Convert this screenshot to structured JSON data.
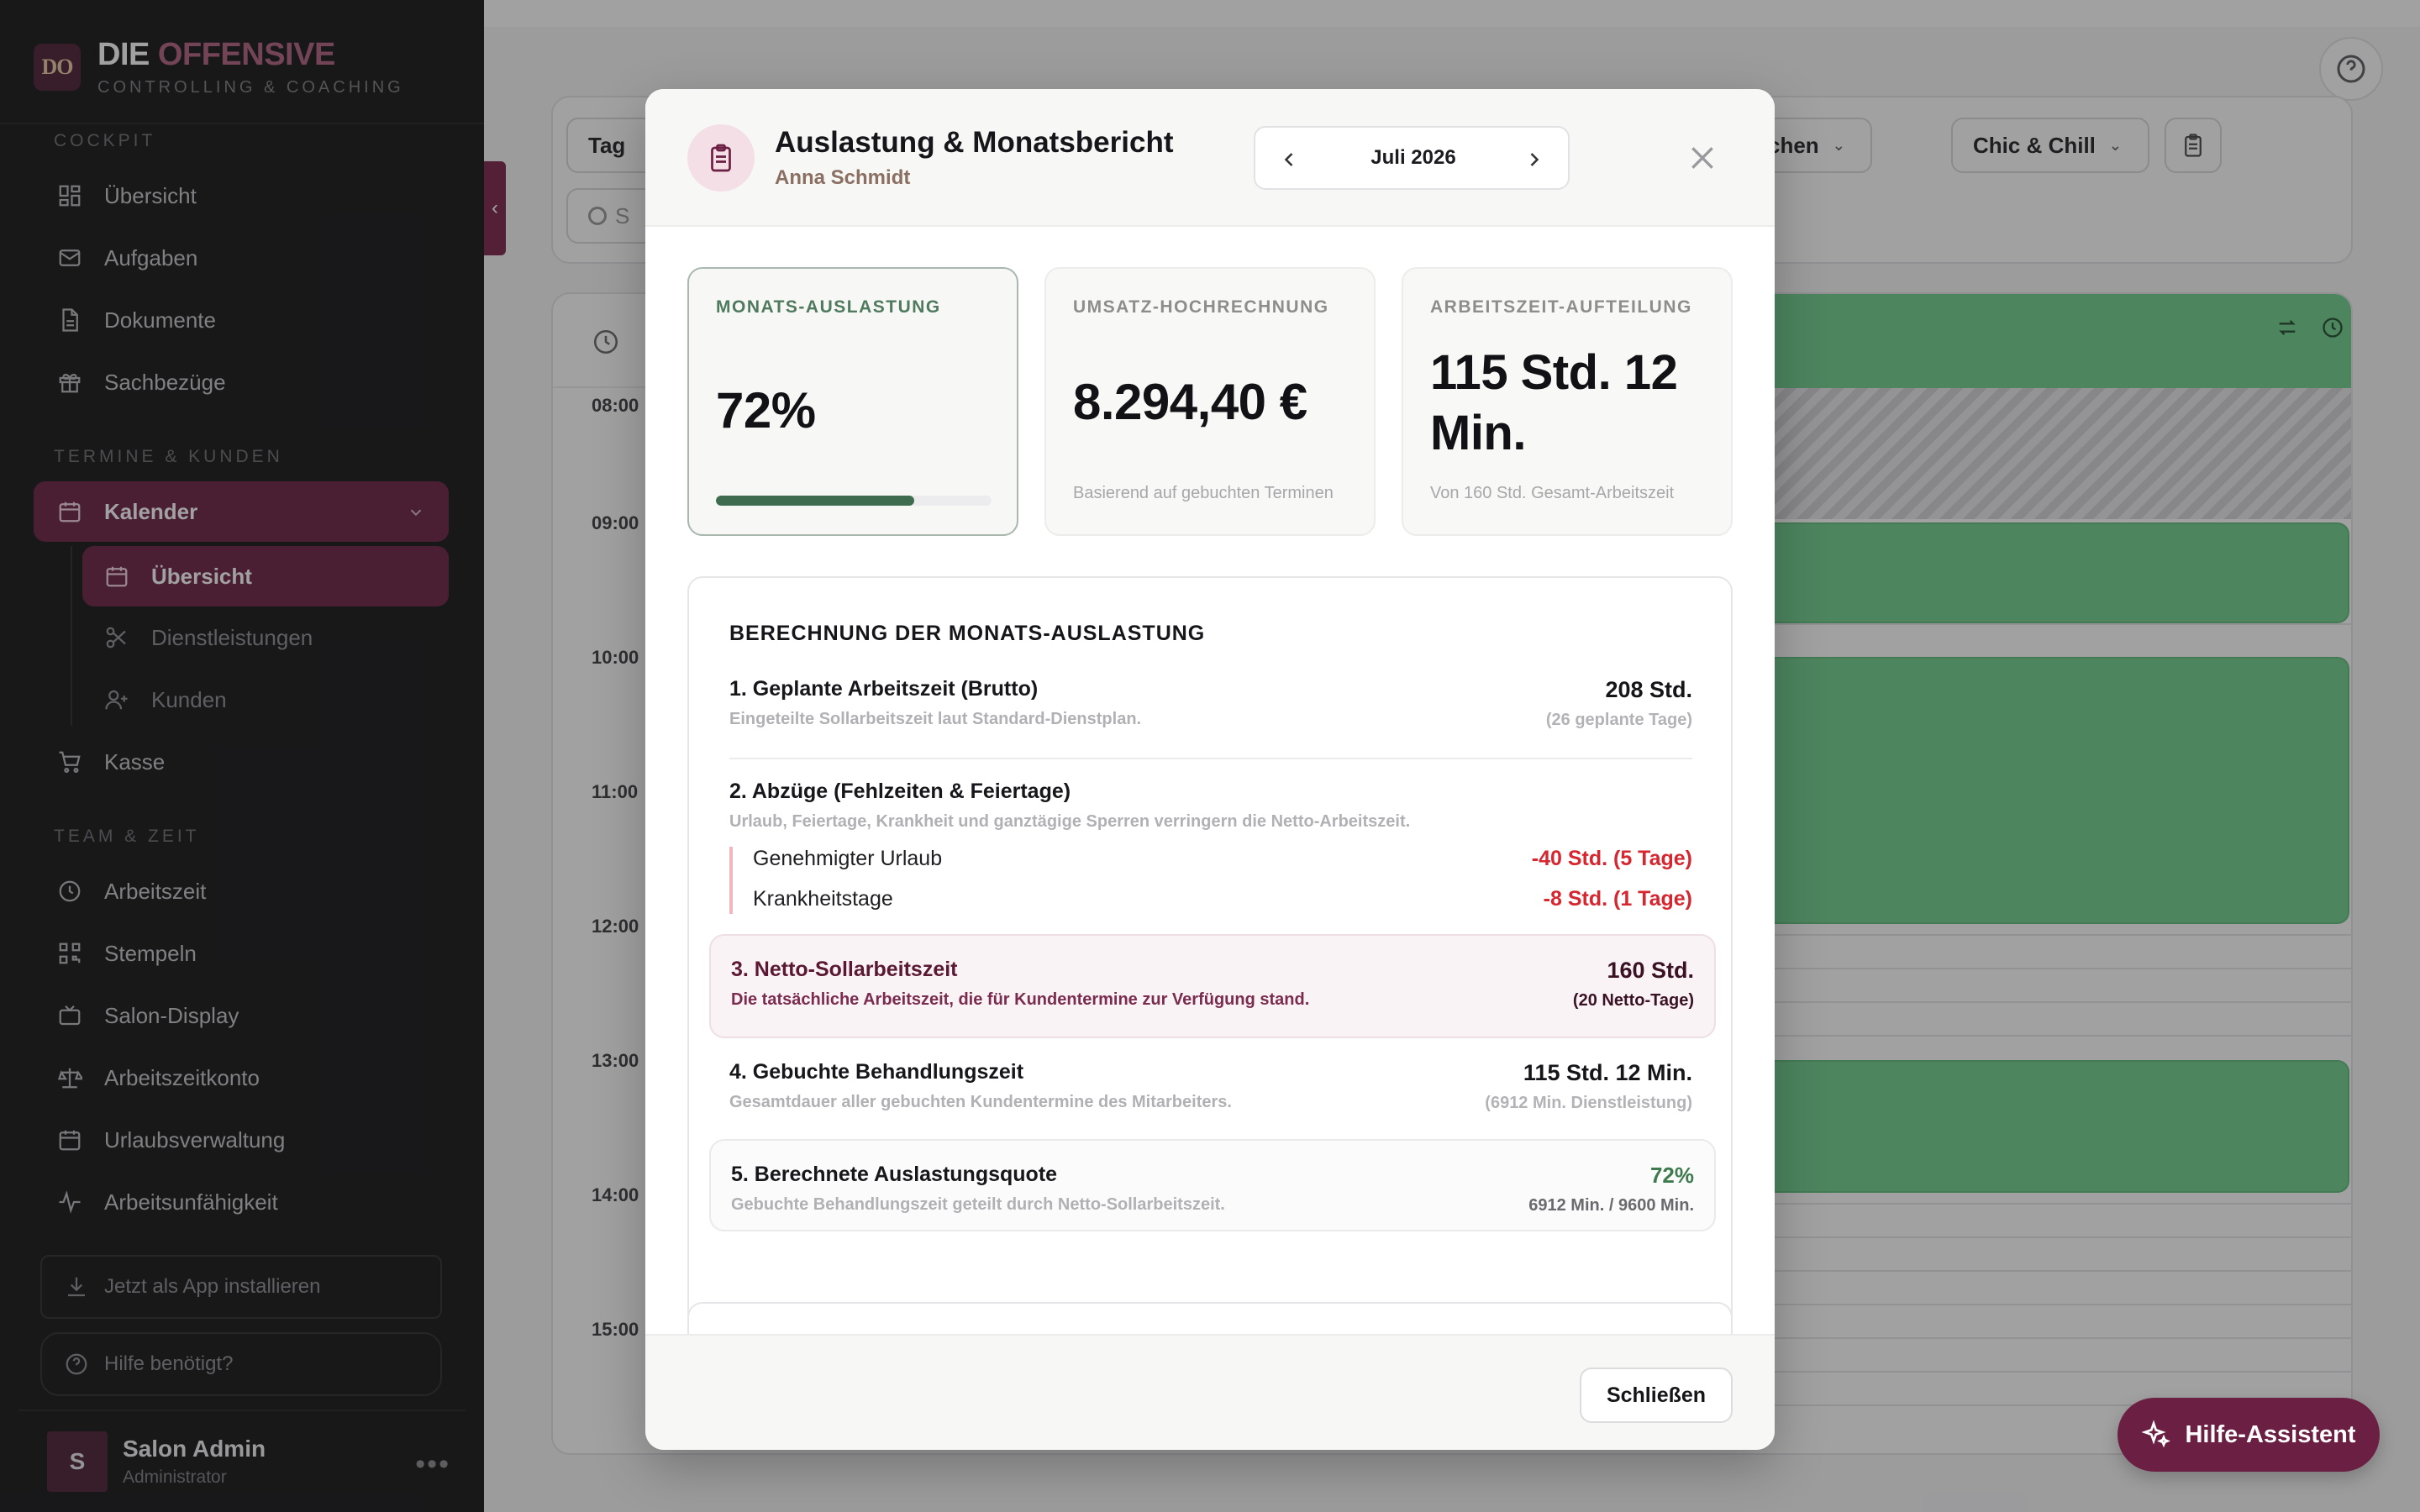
{
  "brand": {
    "badge": "DO",
    "title_a": "DIE",
    "title_b": "OFFENSIVE",
    "subtitle": "CONTROLLING & COACHING",
    "accent_color": "#b0607e"
  },
  "sidebar": {
    "sections": {
      "cockpit": "COCKPIT",
      "termine": "TERMINE & KUNDEN",
      "team": "TEAM & ZEIT"
    },
    "cockpit_items": [
      {
        "label": "Übersicht",
        "icon": "dashboard-icon"
      },
      {
        "label": "Aufgaben",
        "icon": "mail-icon"
      },
      {
        "label": "Dokumente",
        "icon": "document-icon"
      },
      {
        "label": "Sachbezüge",
        "icon": "gift-icon"
      }
    ],
    "kalender": {
      "label": "Kalender",
      "icon": "calendar-icon"
    },
    "kalender_sub": [
      {
        "label": "Übersicht",
        "icon": "calendar-icon",
        "active": true
      },
      {
        "label": "Dienstleistungen",
        "icon": "scissors-icon"
      },
      {
        "label": "Kunden",
        "icon": "user-plus-icon"
      }
    ],
    "kasse": {
      "label": "Kasse",
      "icon": "cart-icon"
    },
    "team_items": [
      {
        "label": "Arbeitszeit",
        "icon": "clock-icon"
      },
      {
        "label": "Stempeln",
        "icon": "qr-icon"
      },
      {
        "label": "Salon-Display",
        "icon": "tv-icon"
      },
      {
        "label": "Arbeitszeitkonto",
        "icon": "scale-icon"
      },
      {
        "label": "Urlaubsverwaltung",
        "icon": "calendar-icon"
      },
      {
        "label": "Arbeitsunfähigkeit",
        "icon": "pulse-icon"
      }
    ],
    "install_label": "Jetzt als App installieren",
    "help_label": "Hilfe benötigt?",
    "user": {
      "initial": "S",
      "name": "Salon Admin",
      "role": "Administrator"
    }
  },
  "background": {
    "filters": {
      "tag": "Tag",
      "search_fragment": "S",
      "chip_partial": "chen",
      "salon": "Chic & Chill"
    },
    "hours": [
      "08:00",
      "09:00",
      "10:00",
      "11:00",
      "12:00",
      "13:00",
      "14:00",
      "15:00"
    ],
    "appointment_color": "#6fcf8d"
  },
  "modal": {
    "title": "Auslastung & Monatsbericht",
    "employee": "Anna Schmidt",
    "month": "Juli 2026",
    "kpis": [
      {
        "label": "MONATS-AUSLASTUNG",
        "value": "72%",
        "progress_percent": 72
      },
      {
        "label": "UMSATZ-HOCHRECHNUNG",
        "value": "8.294,40 €",
        "note": "Basierend auf gebuchten Terminen"
      },
      {
        "label": "ARBEITSZEIT-AUFTEILUNG",
        "value_line1": "115 Std. 12",
        "value_line2": "Min.",
        "note": "Von 160 Std. Gesamt-Arbeitszeit"
      }
    ],
    "calc": {
      "title": "BERECHNUNG DER MONATS-AUSLASTUNG",
      "step1": {
        "label": "1. Geplante Arbeitszeit (Brutto)",
        "desc": "Eingeteilte Sollarbeitszeit laut Standard-Dienstplan.",
        "value": "208 Std.",
        "sub": "(26 geplante Tage)"
      },
      "step2": {
        "label": "2. Abzüge (Fehlzeiten & Feiertage)",
        "desc": "Urlaub, Feiertage, Krankheit und ganztägige Sperren verringern die Netto-Arbeitszeit."
      },
      "deductions": [
        {
          "label": "Genehmigter Urlaub",
          "value": "-40 Std. (5 Tage)"
        },
        {
          "label": "Krankheitstage",
          "value": "-8 Std. (1 Tage)"
        }
      ],
      "step3": {
        "label": "3. Netto-Sollarbeitszeit",
        "desc": "Die tatsächliche Arbeitszeit, die für Kundentermine zur Verfügung stand.",
        "value": "160 Std.",
        "sub": "(20 Netto-Tage)"
      },
      "step4": {
        "label": "4. Gebuchte Behandlungszeit",
        "desc": "Gesamtdauer aller gebuchten Kundentermine des Mitarbeiters.",
        "value": "115 Std. 12 Min.",
        "sub": "(6912 Min. Dienstleistung)"
      },
      "step5": {
        "label": "5. Berechnete Auslastungsquote",
        "desc": "Gebuchte Behandlungszeit geteilt durch Netto-Sollarbeitszeit.",
        "value": "72%",
        "sub": "6912 Min. / 9600 Min."
      }
    },
    "close_label": "Schließen"
  },
  "assistant_label": "Hilfe-Assistent"
}
